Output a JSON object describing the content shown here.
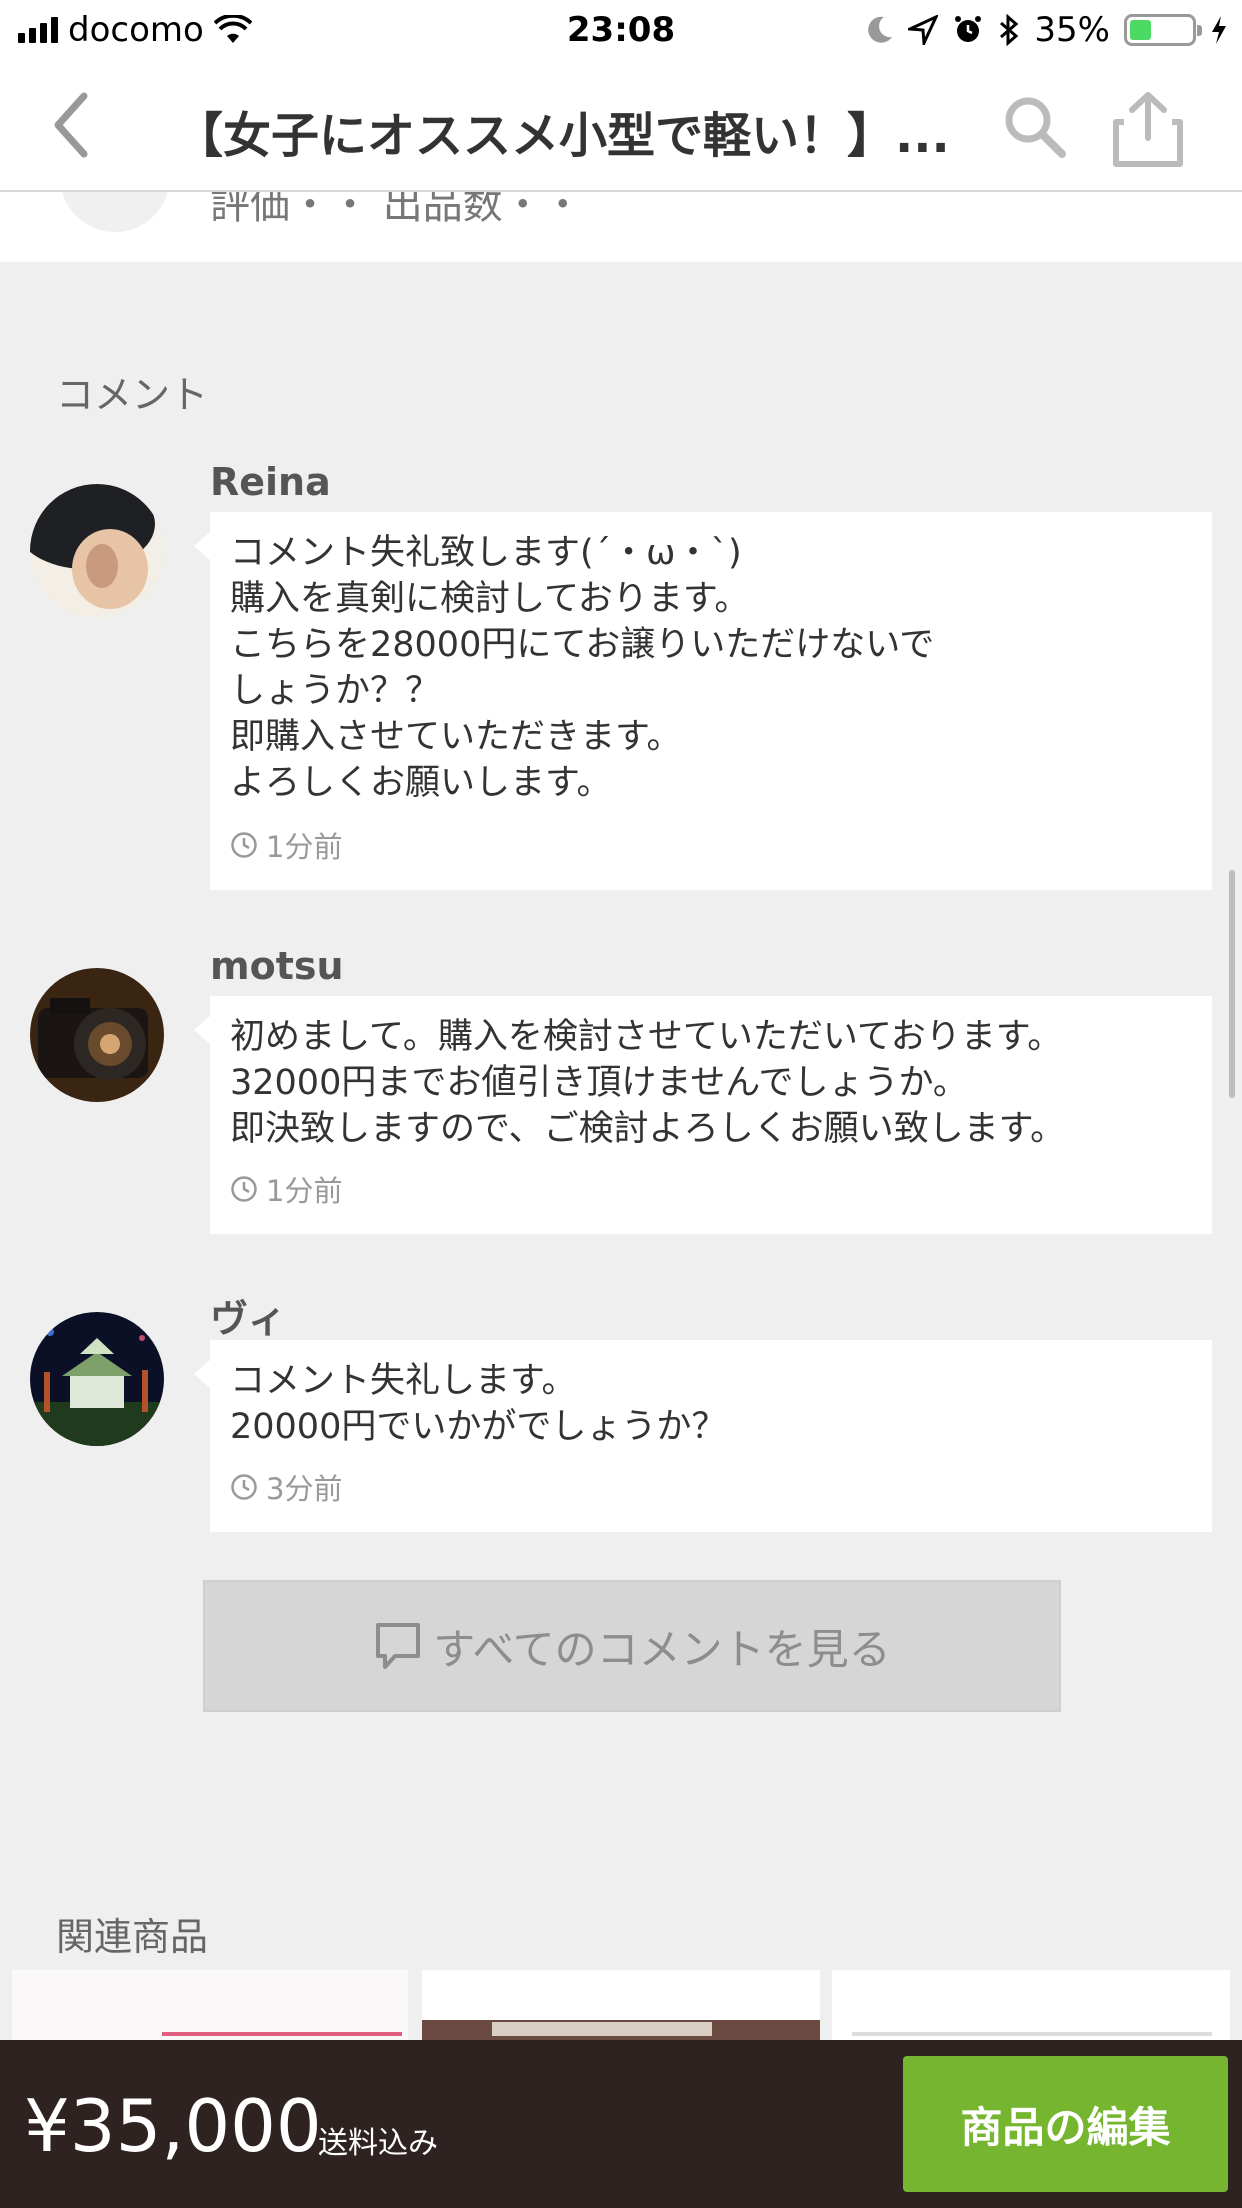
{
  "status_bar": {
    "carrier": "docomo",
    "time": "23:08",
    "battery": "35%"
  },
  "nav": {
    "title": "【女子にオススメ小型で軽い！】..."
  },
  "seller_strip": {
    "partial_text": "評価・・ 出品数・・"
  },
  "comments_section": {
    "label": "コメント"
  },
  "comments": [
    {
      "name": "Reina",
      "text": "コメント失礼致します(´・ω・`)\n購入を真剣に検討しております。\nこちらを28000円にてお譲りいただけないで\nしょうか？？\n即購入させていただきます。\nよろしくお願いします。",
      "time": "1分前"
    },
    {
      "name": "motsu",
      "text": "初めまして。購入を検討させていただいております。\n32000円までお値引き頂けませんでしょうか。\n即決致しますので、ご検討よろしくお願い致します。",
      "time": "1分前"
    },
    {
      "name": "ヴィ",
      "text": "コメント失礼します。\n20000円でいかがでしょうか？",
      "time": "3分前"
    }
  ],
  "see_all": {
    "label": "すべてのコメントを見る"
  },
  "related": {
    "label": "関連商品"
  },
  "bottom": {
    "price": "¥35,000",
    "shipping": "送料込み",
    "edit_label": "商品の編集"
  },
  "colors": {
    "accent_green": "#76b530",
    "bottom_bg": "#2e2320",
    "page_bg": "#efefef"
  }
}
